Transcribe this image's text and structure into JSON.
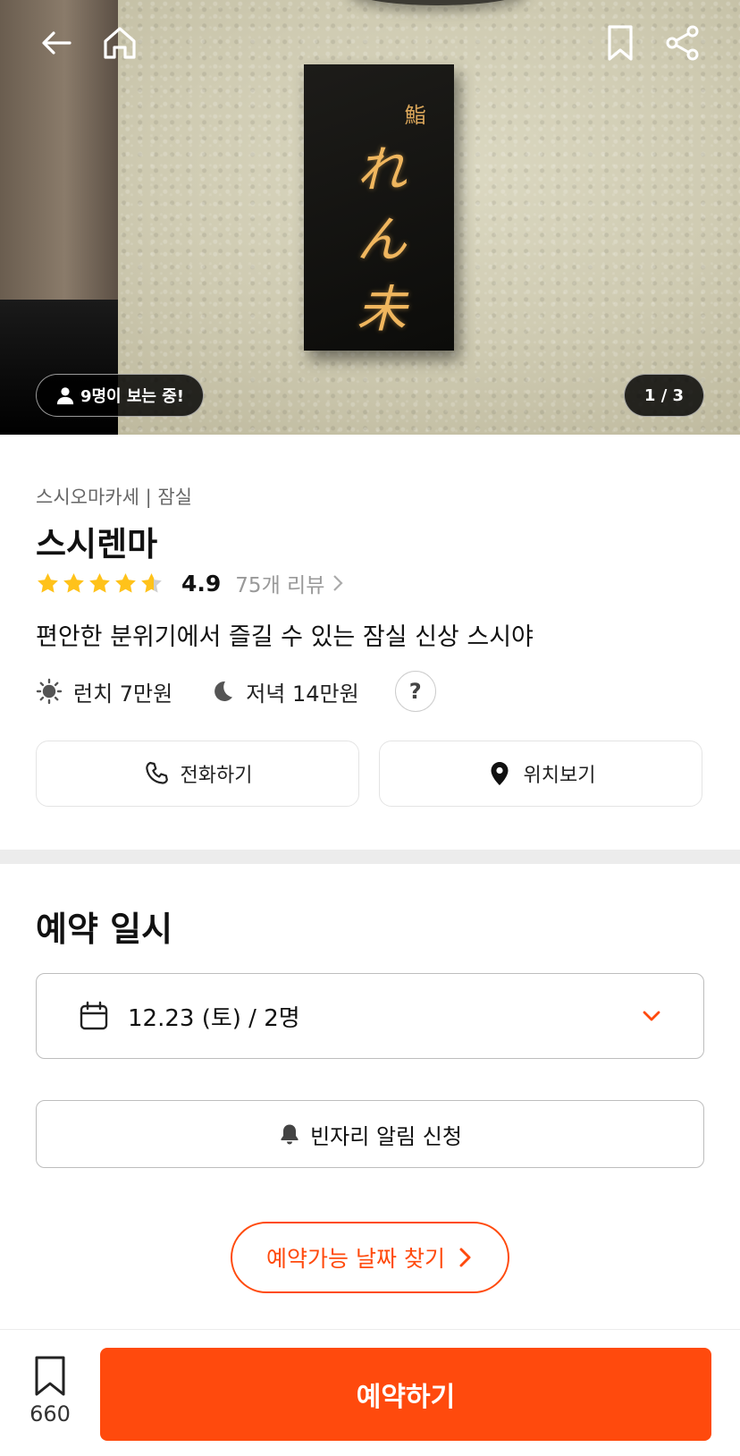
{
  "hero": {
    "sign_small_text": "鮨",
    "sign_big_text": "れん未",
    "viewers_label": "9명이 보는 중!",
    "image_counter": "1 / 3"
  },
  "restaurant": {
    "category": "스시오마카세 | 잠실",
    "name": "스시렌마",
    "rating": "4.9",
    "review_link": "75개 리뷰",
    "description": "편안한 분위기에서 즐길 수 있는 잠실 신상 스시야",
    "lunch_price": "런치 7만원",
    "dinner_price": "저녁 14만원",
    "help_label": "?",
    "star_color": "#FFC21A"
  },
  "actions": {
    "call_label": "전화하기",
    "map_label": "위치보기"
  },
  "reservation": {
    "section_title": "예약 일시",
    "selected_date": "12.23 (토) / 2명",
    "alert_label": "빈자리 알림 신청",
    "find_dates_label": "예약가능 날짜 찾기"
  },
  "bottom_bar": {
    "save_count": "660",
    "reserve_label": "예약하기",
    "accent_color": "#FF4A0D"
  },
  "icons": [
    "back-arrow-icon",
    "home-icon",
    "bookmark-icon",
    "share-icon",
    "person-icon",
    "star-icon",
    "chevron-right-icon",
    "sun-icon",
    "moon-icon",
    "phone-icon",
    "location-pin-icon",
    "calendar-icon",
    "chevron-down-icon",
    "bell-icon"
  ]
}
